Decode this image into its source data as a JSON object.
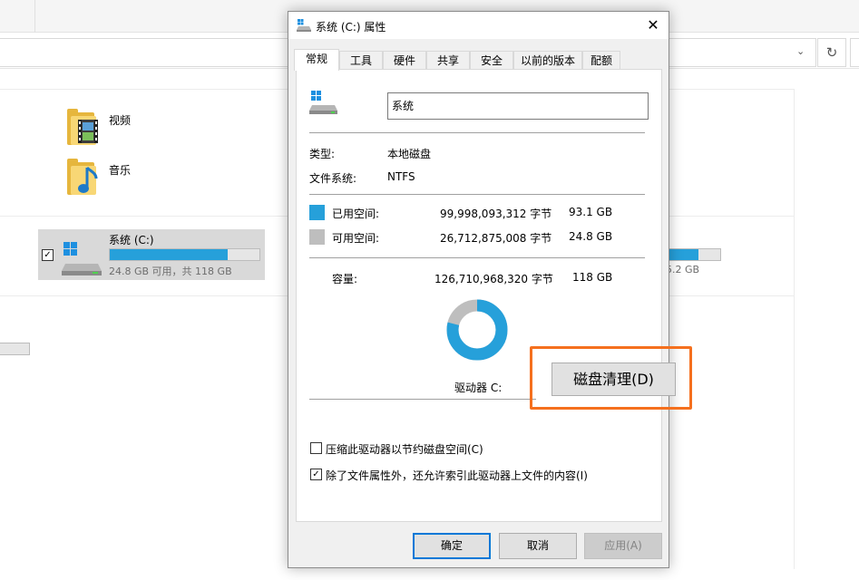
{
  "explorer": {
    "folders": [
      {
        "label": "视频",
        "icon": "video-folder-icon"
      },
      {
        "label": "音乐",
        "icon": "music-folder-icon"
      }
    ],
    "drive": {
      "name": "系统 (C:)",
      "info": "24.8 GB 可用，共 118 GB",
      "used_fraction": 0.79,
      "checked": true
    },
    "right_drive_info": "5.2 GB",
    "refresh_icon": "↻",
    "chevron": "⌄"
  },
  "dialog": {
    "title": "系统 (C:) 属性",
    "close": "✕",
    "tabs": [
      "常规",
      "工具",
      "硬件",
      "共享",
      "安全",
      "以前的版本",
      "配额"
    ],
    "active_tab": 0,
    "name_value": "系统",
    "type_label": "类型:",
    "type_value": "本地磁盘",
    "fs_label": "文件系统:",
    "fs_value": "NTFS",
    "used": {
      "label": "已用空间:",
      "bytes": "99,998,093,312 字节",
      "size": "93.1 GB",
      "color": "#26a0da"
    },
    "free": {
      "label": "可用空间:",
      "bytes": "26,712,875,008 字节",
      "size": "24.8 GB",
      "color": "#bebebe"
    },
    "capacity": {
      "label": "容量:",
      "bytes": "126,710,968,320 字节",
      "size": "118 GB"
    },
    "used_fraction": 0.789,
    "drive_label": "驱动器 C:",
    "cleanup_button": "磁盘清理(D)",
    "highlight_color": "#f5701e",
    "compress_label": "压缩此驱动器以节约磁盘空间(C)",
    "compress_checked": false,
    "index_label": "除了文件属性外，还允许索引此驱动器上文件的内容(I)",
    "index_checked": true,
    "ok": "确定",
    "cancel": "取消",
    "apply": "应用(A)"
  }
}
